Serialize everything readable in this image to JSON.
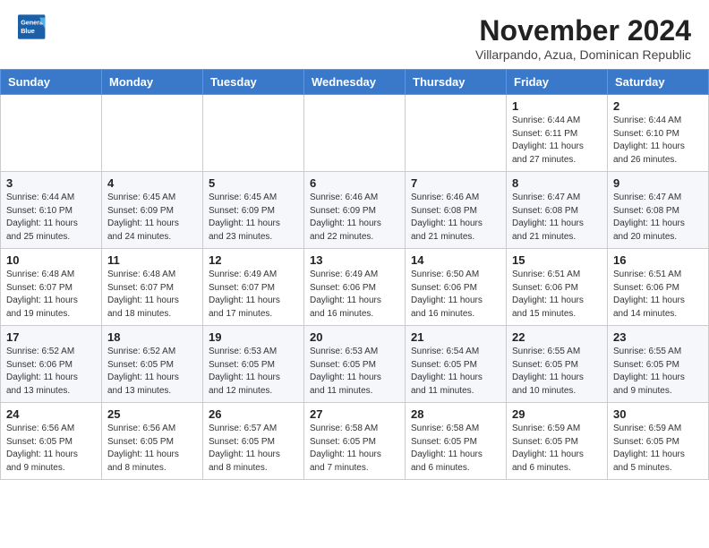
{
  "header": {
    "logo": {
      "line1": "General",
      "line2": "Blue"
    },
    "title": "November 2024",
    "subtitle": "Villarpando, Azua, Dominican Republic"
  },
  "days_of_week": [
    "Sunday",
    "Monday",
    "Tuesday",
    "Wednesday",
    "Thursday",
    "Friday",
    "Saturday"
  ],
  "weeks": [
    [
      {
        "day": "",
        "info": ""
      },
      {
        "day": "",
        "info": ""
      },
      {
        "day": "",
        "info": ""
      },
      {
        "day": "",
        "info": ""
      },
      {
        "day": "",
        "info": ""
      },
      {
        "day": "1",
        "info": "Sunrise: 6:44 AM\nSunset: 6:11 PM\nDaylight: 11 hours\nand 27 minutes."
      },
      {
        "day": "2",
        "info": "Sunrise: 6:44 AM\nSunset: 6:10 PM\nDaylight: 11 hours\nand 26 minutes."
      }
    ],
    [
      {
        "day": "3",
        "info": "Sunrise: 6:44 AM\nSunset: 6:10 PM\nDaylight: 11 hours\nand 25 minutes."
      },
      {
        "day": "4",
        "info": "Sunrise: 6:45 AM\nSunset: 6:09 PM\nDaylight: 11 hours\nand 24 minutes."
      },
      {
        "day": "5",
        "info": "Sunrise: 6:45 AM\nSunset: 6:09 PM\nDaylight: 11 hours\nand 23 minutes."
      },
      {
        "day": "6",
        "info": "Sunrise: 6:46 AM\nSunset: 6:09 PM\nDaylight: 11 hours\nand 22 minutes."
      },
      {
        "day": "7",
        "info": "Sunrise: 6:46 AM\nSunset: 6:08 PM\nDaylight: 11 hours\nand 21 minutes."
      },
      {
        "day": "8",
        "info": "Sunrise: 6:47 AM\nSunset: 6:08 PM\nDaylight: 11 hours\nand 21 minutes."
      },
      {
        "day": "9",
        "info": "Sunrise: 6:47 AM\nSunset: 6:08 PM\nDaylight: 11 hours\nand 20 minutes."
      }
    ],
    [
      {
        "day": "10",
        "info": "Sunrise: 6:48 AM\nSunset: 6:07 PM\nDaylight: 11 hours\nand 19 minutes."
      },
      {
        "day": "11",
        "info": "Sunrise: 6:48 AM\nSunset: 6:07 PM\nDaylight: 11 hours\nand 18 minutes."
      },
      {
        "day": "12",
        "info": "Sunrise: 6:49 AM\nSunset: 6:07 PM\nDaylight: 11 hours\nand 17 minutes."
      },
      {
        "day": "13",
        "info": "Sunrise: 6:49 AM\nSunset: 6:06 PM\nDaylight: 11 hours\nand 16 minutes."
      },
      {
        "day": "14",
        "info": "Sunrise: 6:50 AM\nSunset: 6:06 PM\nDaylight: 11 hours\nand 16 minutes."
      },
      {
        "day": "15",
        "info": "Sunrise: 6:51 AM\nSunset: 6:06 PM\nDaylight: 11 hours\nand 15 minutes."
      },
      {
        "day": "16",
        "info": "Sunrise: 6:51 AM\nSunset: 6:06 PM\nDaylight: 11 hours\nand 14 minutes."
      }
    ],
    [
      {
        "day": "17",
        "info": "Sunrise: 6:52 AM\nSunset: 6:06 PM\nDaylight: 11 hours\nand 13 minutes."
      },
      {
        "day": "18",
        "info": "Sunrise: 6:52 AM\nSunset: 6:05 PM\nDaylight: 11 hours\nand 13 minutes."
      },
      {
        "day": "19",
        "info": "Sunrise: 6:53 AM\nSunset: 6:05 PM\nDaylight: 11 hours\nand 12 minutes."
      },
      {
        "day": "20",
        "info": "Sunrise: 6:53 AM\nSunset: 6:05 PM\nDaylight: 11 hours\nand 11 minutes."
      },
      {
        "day": "21",
        "info": "Sunrise: 6:54 AM\nSunset: 6:05 PM\nDaylight: 11 hours\nand 11 minutes."
      },
      {
        "day": "22",
        "info": "Sunrise: 6:55 AM\nSunset: 6:05 PM\nDaylight: 11 hours\nand 10 minutes."
      },
      {
        "day": "23",
        "info": "Sunrise: 6:55 AM\nSunset: 6:05 PM\nDaylight: 11 hours\nand 9 minutes."
      }
    ],
    [
      {
        "day": "24",
        "info": "Sunrise: 6:56 AM\nSunset: 6:05 PM\nDaylight: 11 hours\nand 9 minutes."
      },
      {
        "day": "25",
        "info": "Sunrise: 6:56 AM\nSunset: 6:05 PM\nDaylight: 11 hours\nand 8 minutes."
      },
      {
        "day": "26",
        "info": "Sunrise: 6:57 AM\nSunset: 6:05 PM\nDaylight: 11 hours\nand 8 minutes."
      },
      {
        "day": "27",
        "info": "Sunrise: 6:58 AM\nSunset: 6:05 PM\nDaylight: 11 hours\nand 7 minutes."
      },
      {
        "day": "28",
        "info": "Sunrise: 6:58 AM\nSunset: 6:05 PM\nDaylight: 11 hours\nand 6 minutes."
      },
      {
        "day": "29",
        "info": "Sunrise: 6:59 AM\nSunset: 6:05 PM\nDaylight: 11 hours\nand 6 minutes."
      },
      {
        "day": "30",
        "info": "Sunrise: 6:59 AM\nSunset: 6:05 PM\nDaylight: 11 hours\nand 5 minutes."
      }
    ]
  ]
}
